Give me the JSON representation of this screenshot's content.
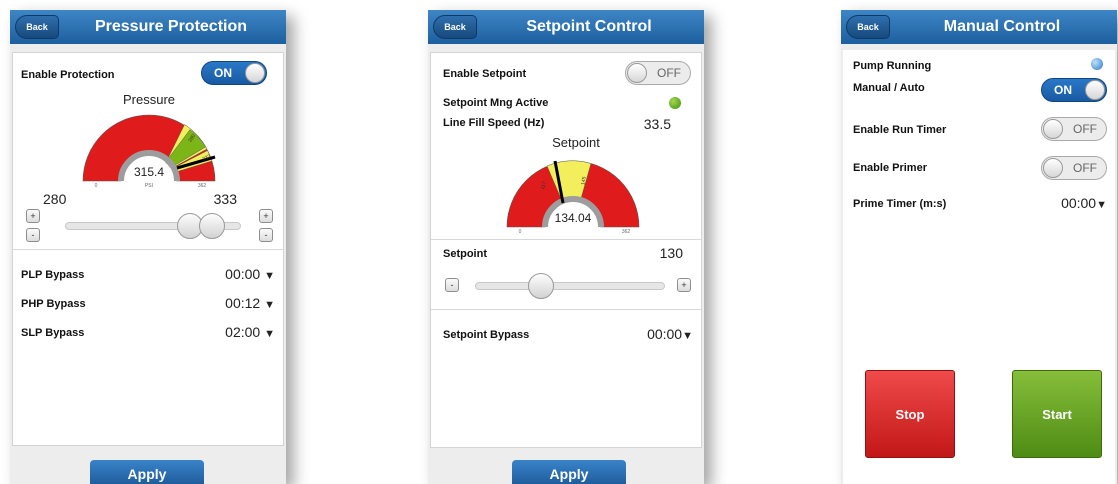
{
  "pressure": {
    "back_label": "Back",
    "title": "Pressure Protection",
    "enable_label": "Enable Protection",
    "enable_state": "ON",
    "gauge": {
      "title": "Pressure",
      "value": "315.4",
      "unit": "PSI",
      "min": "0",
      "max": "362",
      "band1": "280",
      "band2": "333"
    },
    "range_low": "280",
    "range_high": "333",
    "plus": "+",
    "minus": "-",
    "rows": [
      {
        "label": "PLP Bypass",
        "value": "00:00"
      },
      {
        "label": "PHP Bypass",
        "value": "00:12"
      },
      {
        "label": "SLP Bypass",
        "value": "02:00"
      }
    ],
    "apply_label": "Apply"
  },
  "setpoint": {
    "back_label": "Back",
    "title": "Setpoint Control",
    "enable_label": "Enable Setpoint",
    "enable_state": "OFF",
    "mng_label": "Setpoint Mng Active",
    "fill_label": "Line Fill Speed (Hz)",
    "fill_value": "33.5",
    "gauge": {
      "title": "Setpoint",
      "value": "134.04",
      "min": "0",
      "max": "362",
      "band1": "117",
      "band2": "145"
    },
    "sp_label": "Setpoint",
    "sp_value": "130",
    "plus": "+",
    "minus": "-",
    "bypass_label": "Setpoint Bypass",
    "bypass_value": "00:00",
    "apply_label": "Apply"
  },
  "manual": {
    "back_label": "Back",
    "title": "Manual Control",
    "pump_label": "Pump Running",
    "mode_label": "Manual / Auto",
    "mode_state": "ON",
    "runtimer_label": "Enable Run Timer",
    "runtimer_state": "OFF",
    "primer_label": "Enable Primer",
    "primer_state": "OFF",
    "prime_timer_label": "Prime Timer (m:s)",
    "prime_timer_value": "00:00",
    "stop_label": "Stop",
    "start_label": "Start"
  },
  "caret": "▼",
  "colors": {
    "header": "#1d5f9e",
    "toggle_on": "#1f66b0",
    "danger": "#e01b1b",
    "caution": "#f3ee5c",
    "ok": "#7cb518",
    "indicator_green": "#4e9a16",
    "indicator_blue": "#2a77c6"
  }
}
